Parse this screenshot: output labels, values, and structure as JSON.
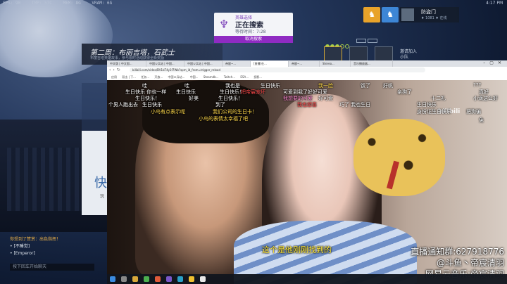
{
  "game": {
    "stats": [
      "FPS: 90",
      "TMP: 57C",
      "MEM: 8G",
      "VRAM: 6G"
    ],
    "clock": "4:17 PM"
  },
  "search": {
    "hero_label": "英雄选择",
    "title": "正在搜索",
    "wait": "等待时间：7:28",
    "cancel": "取消搜索"
  },
  "social": {
    "btn1": "♞",
    "btn2": "♞"
  },
  "profile": {
    "name": "防盗门",
    "tag": "♦ 1081 ♦ 在线"
  },
  "group": {
    "slots": 5,
    "filled": 3,
    "invite": [
      "邀请加入",
      "小队"
    ]
  },
  "map": {
    "title": "第二周：布丽吉塔，石武士",
    "subtitle": "布丽吉塔英雄故事，参与限时活动获得全新奖励"
  },
  "side_panel": {
    "big": "快",
    "small": "玩"
  },
  "chat": {
    "line1": "你受到了赞赏：出色指挥！",
    "line2": "• [不睡觉]",
    "line3": "• [Emperor]",
    "input": "按下回车开始聊天"
  },
  "browser": {
    "tabs": [
      "中文版 | 中文国...",
      "中国Ｕ兵站 | 中国...",
      "中国Ｕ兵站 | 中国...",
      "帝宸~...",
      "[直播]在...",
      "帝宸~...",
      "Stereo...",
      "音乐播放器..."
    ],
    "url": "bilibili.com/video/BV1bT4y1f7Wb?spm_id_from=trigger_reload",
    "bookmarks": [
      "应用",
      "双击 | 下...",
      "任务...",
      "开放...",
      "中国Ｕ兵站...",
      "中国...",
      "Steamdb...",
      "Twitch...",
      "ESA...",
      "投影..."
    ]
  },
  "video": {
    "danmaku": [
      {
        "text": "哇",
        "c": ""
      },
      {
        "text": "哇",
        "c": ""
      },
      {
        "text": "我也是",
        "c": ""
      },
      {
        "text": "生日快乐",
        "c": ""
      },
      {
        "text": "我一脸",
        "c": "y"
      },
      {
        "text": "饭了",
        "c": ""
      },
      {
        "text": "好帆",
        "c": ""
      },
      {
        "text": "???",
        "c": ""
      },
      {
        "text": "生日快乐 你也一样",
        "c": ""
      },
      {
        "text": "生日快乐",
        "c": ""
      },
      {
        "text": "生日快乐！",
        "c": ""
      },
      {
        "text": "把帝宸宠坏",
        "c": "r"
      },
      {
        "text": "可爱到我了好好可爱",
        "c": ""
      },
      {
        "text": "亲狗了",
        "c": ""
      },
      {
        "text": "真好",
        "c": ""
      },
      {
        "text": "生日快乐！",
        "c": ""
      },
      {
        "text": "好美",
        "c": ""
      },
      {
        "text": "生日快乐！",
        "c": ""
      },
      {
        "text": "我想要的可爱",
        "c": "p"
      },
      {
        "text": "好可爱",
        "c": ""
      },
      {
        "text": "十二礼",
        "c": ""
      },
      {
        "text": "小滴这么好",
        "c": ""
      },
      {
        "text": "个男人跑出去",
        "c": ""
      },
      {
        "text": "生日快乐",
        "c": ""
      },
      {
        "text": "到了",
        "c": ""
      },
      {
        "text": "我也想喜",
        "c": "r"
      },
      {
        "text": "巧了 我也生日",
        "c": ""
      },
      {
        "text": "生日快乐",
        "c": ""
      },
      {
        "text": "小鸟有点表示呢",
        "c": "y"
      },
      {
        "text": "我们公司的生日卡！",
        "c": "y"
      },
      {
        "text": "身份证生日快乐",
        "c": ""
      },
      {
        "text": "小鸟的表情太幸福了吧",
        "c": "y"
      },
      {
        "text": "把狗骗",
        "c": ""
      },
      {
        "text": "免",
        "c": ""
      }
    ],
    "subtitle": "这个是他刚刚找到的",
    "watermark": "bilibili",
    "info": [
      "直播通知群:627918776",
      "@斗鱼丶帝宸清羽",
      "网易云音乐:帝宸清羽"
    ]
  }
}
